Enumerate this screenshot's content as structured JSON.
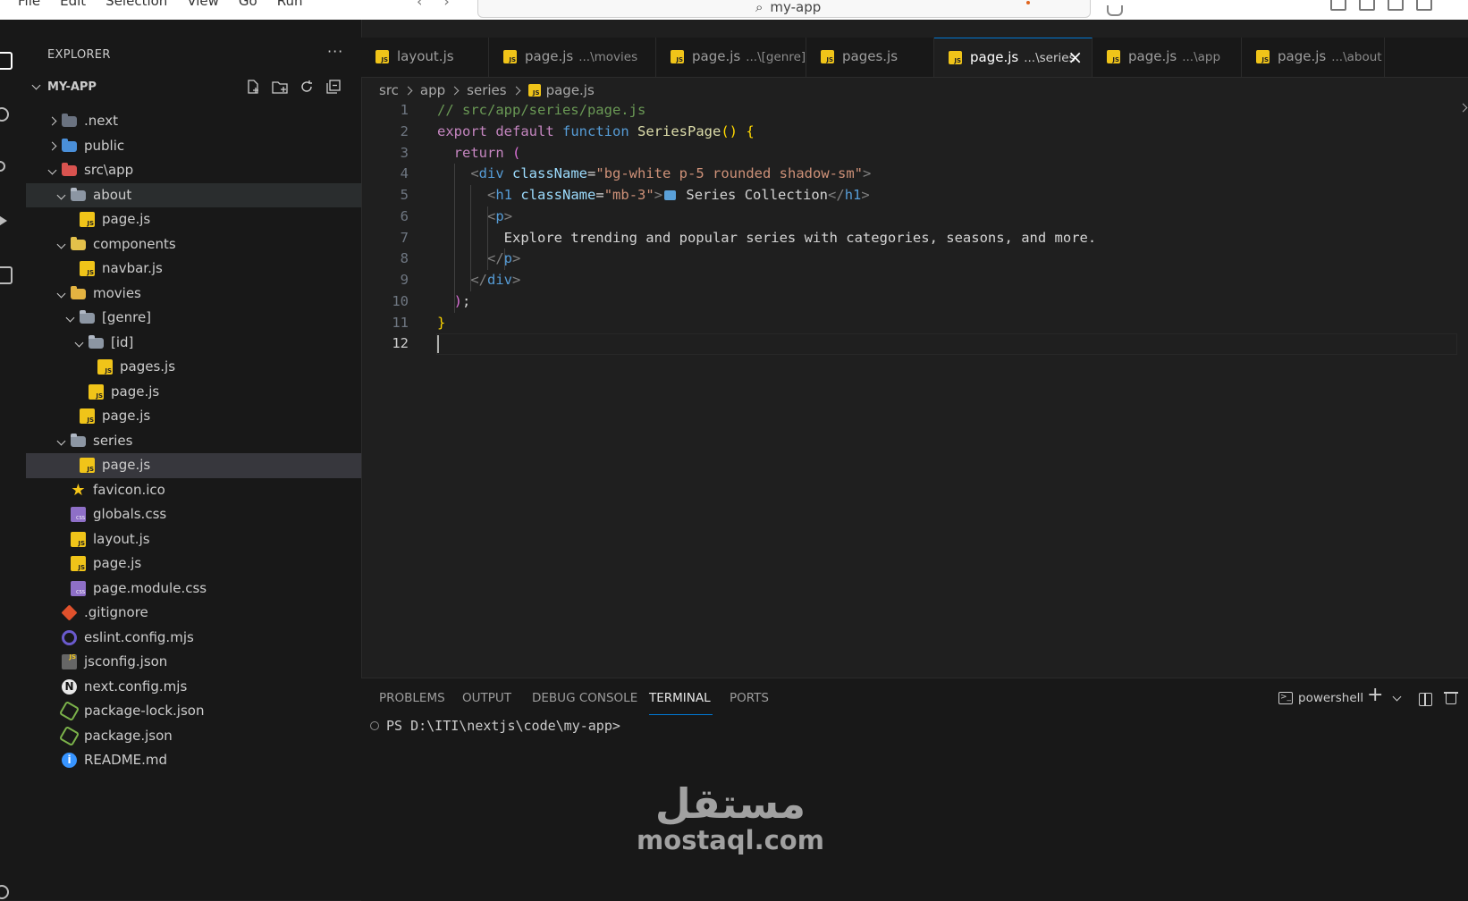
{
  "menu": [
    "File",
    "Edit",
    "Selection",
    "View",
    "Go",
    "Run"
  ],
  "command_center": {
    "text": "my-app"
  },
  "sidebar": {
    "header": "EXPLORER",
    "more": "···",
    "section": "MY-APP",
    "tree": [
      {
        "label": ".next",
        "kind": "folder-next",
        "depth": 0,
        "chevron": "right"
      },
      {
        "label": "public",
        "kind": "folder-public",
        "depth": 0,
        "chevron": "right"
      },
      {
        "label": "src\\app",
        "kind": "folder-src",
        "depth": 0,
        "chevron": "down"
      },
      {
        "label": "about",
        "kind": "folder-open",
        "depth": 1,
        "chevron": "down",
        "state": "hover"
      },
      {
        "label": "page.js",
        "kind": "js",
        "depth": 2
      },
      {
        "label": "components",
        "kind": "folder-comp",
        "depth": 1,
        "chevron": "down"
      },
      {
        "label": "navbar.js",
        "kind": "js",
        "depth": 2
      },
      {
        "label": "movies",
        "kind": "folder-yellow",
        "depth": 1,
        "chevron": "down"
      },
      {
        "label": "[genre]",
        "kind": "folder-open",
        "depth": 2,
        "chevron": "down"
      },
      {
        "label": "[id]",
        "kind": "folder-open",
        "depth": 3,
        "chevron": "down"
      },
      {
        "label": "pages.js",
        "kind": "js",
        "depth": 4
      },
      {
        "label": "page.js",
        "kind": "js",
        "depth": 3
      },
      {
        "label": "page.js",
        "kind": "js",
        "depth": 2
      },
      {
        "label": "series",
        "kind": "folder-open",
        "depth": 1,
        "chevron": "down"
      },
      {
        "label": "page.js",
        "kind": "js",
        "depth": 2,
        "state": "selected"
      },
      {
        "label": "favicon.ico",
        "kind": "star",
        "depth": 1
      },
      {
        "label": "globals.css",
        "kind": "css",
        "depth": 1
      },
      {
        "label": "layout.js",
        "kind": "js",
        "depth": 1
      },
      {
        "label": "page.js",
        "kind": "js",
        "depth": 1
      },
      {
        "label": "page.module.css",
        "kind": "css",
        "depth": 1
      },
      {
        "label": ".gitignore",
        "kind": "git",
        "depth": 0
      },
      {
        "label": "eslint.config.mjs",
        "kind": "eslint",
        "depth": 0
      },
      {
        "label": "jsconfig.json",
        "kind": "json",
        "depth": 0
      },
      {
        "label": "next.config.mjs",
        "kind": "nextcfg",
        "depth": 0
      },
      {
        "label": "package-lock.json",
        "kind": "node",
        "depth": 0
      },
      {
        "label": "package.json",
        "kind": "node",
        "depth": 0
      },
      {
        "label": "README.md",
        "kind": "info",
        "depth": 0
      }
    ]
  },
  "tabs": [
    {
      "name": "layout.js",
      "desc": "",
      "active": false
    },
    {
      "name": "page.js",
      "desc": "...\\movies",
      "active": false
    },
    {
      "name": "page.js",
      "desc": "...\\[genre]",
      "active": false
    },
    {
      "name": "pages.js",
      "desc": "",
      "active": false
    },
    {
      "name": "page.js",
      "desc": "...\\series",
      "active": true
    },
    {
      "name": "page.js",
      "desc": "...\\app",
      "active": false
    },
    {
      "name": "page.js",
      "desc": "...\\about",
      "active": false
    }
  ],
  "breadcrumb": [
    "src",
    "app",
    "series",
    "page.js"
  ],
  "code": {
    "current_line": 12,
    "lines": [
      [
        [
          "t-com",
          "// src/app/series/page.js"
        ]
      ],
      [
        [
          "t-kw",
          "export"
        ],
        [
          "t-txt",
          " "
        ],
        [
          "t-kw",
          "default"
        ],
        [
          "t-txt",
          " "
        ],
        [
          "t-kwb",
          "function"
        ],
        [
          "t-txt",
          " "
        ],
        [
          "t-fn",
          "SeriesPage"
        ],
        [
          "t-br1",
          "()"
        ],
        [
          "t-txt",
          " "
        ],
        [
          "t-br1",
          "{"
        ]
      ],
      [
        [
          "t-txt",
          "  "
        ],
        [
          "t-kw",
          "return"
        ],
        [
          "t-txt",
          " "
        ],
        [
          "t-br2",
          "("
        ]
      ],
      [
        [
          "t-txt",
          "    "
        ],
        [
          "t-tagp",
          "<"
        ],
        [
          "t-tag",
          "div"
        ],
        [
          "t-txt",
          " "
        ],
        [
          "t-attr",
          "className"
        ],
        [
          "t-txt",
          "="
        ],
        [
          "t-str",
          "\"bg-white p-5 rounded shadow-sm\""
        ],
        [
          "t-tagp",
          ">"
        ]
      ],
      [
        [
          "t-txt",
          "      "
        ],
        [
          "t-tagp",
          "<"
        ],
        [
          "t-tag",
          "h1"
        ],
        [
          "t-txt",
          " "
        ],
        [
          "t-attr",
          "className"
        ],
        [
          "t-txt",
          "="
        ],
        [
          "t-str",
          "\"mb-3\""
        ],
        [
          "t-tagp",
          ">"
        ],
        [
          "emoji",
          ""
        ],
        [
          "t-txt",
          " Series Collection"
        ],
        [
          "t-tagp",
          "</"
        ],
        [
          "t-tag",
          "h1"
        ],
        [
          "t-tagp",
          ">"
        ]
      ],
      [
        [
          "t-txt",
          "      "
        ],
        [
          "t-tagp",
          "<"
        ],
        [
          "t-tag",
          "p"
        ],
        [
          "t-tagp",
          ">"
        ]
      ],
      [
        [
          "t-txt",
          "        Explore trending and popular series with categories, seasons, and more."
        ]
      ],
      [
        [
          "t-txt",
          "      "
        ],
        [
          "t-tagp",
          "</"
        ],
        [
          "t-tag",
          "p"
        ],
        [
          "t-tagp",
          ">"
        ]
      ],
      [
        [
          "t-txt",
          "    "
        ],
        [
          "t-tagp",
          "</"
        ],
        [
          "t-tag",
          "div"
        ],
        [
          "t-tagp",
          ">"
        ]
      ],
      [
        [
          "t-txt",
          "  "
        ],
        [
          "t-br2",
          ")"
        ],
        [
          "t-txt",
          ";"
        ]
      ],
      [
        [
          "t-br1",
          "}"
        ]
      ],
      []
    ]
  },
  "panel": {
    "tabs": [
      "PROBLEMS",
      "OUTPUT",
      "DEBUG CONSOLE",
      "TERMINAL",
      "PORTS"
    ],
    "active_tab": "TERMINAL",
    "shell": "powershell",
    "prompt": "PS D:\\ITI\\nextjs\\code\\my-app>"
  },
  "watermark": {
    "arabic": "مستقل",
    "latin": "mostaql.com"
  }
}
